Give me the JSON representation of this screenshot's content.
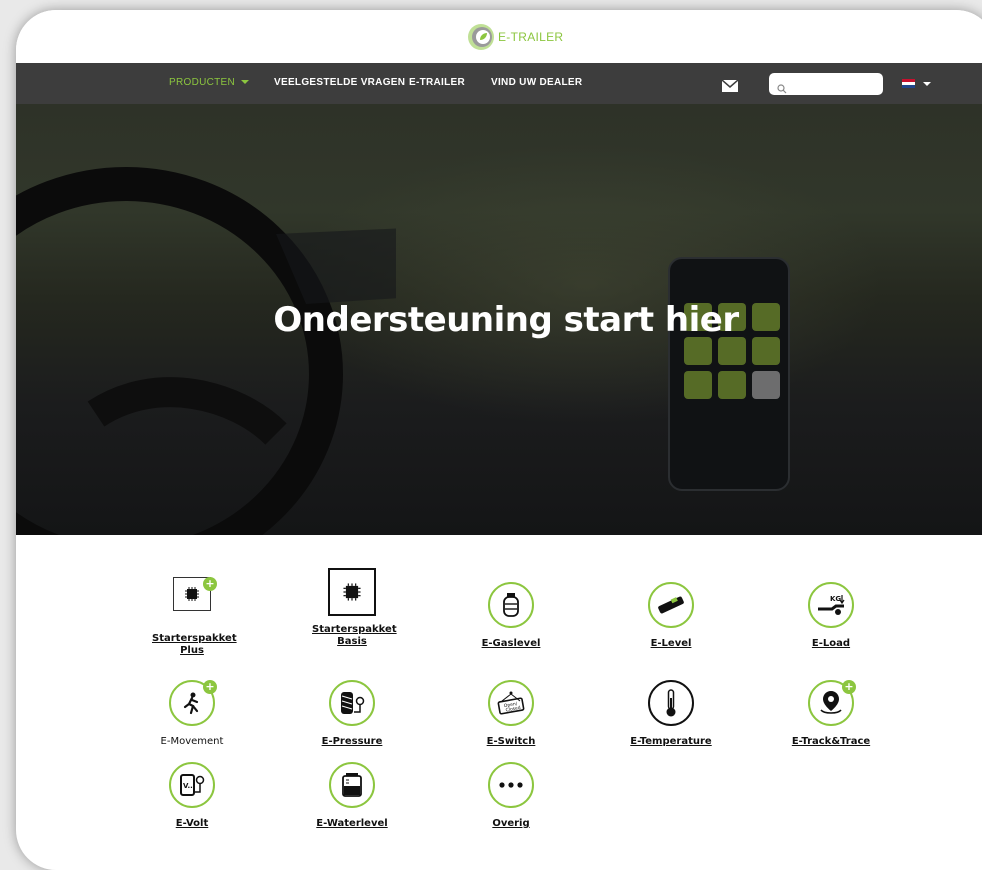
{
  "brand": {
    "logo_text": "E-TRAILER",
    "accent": "#8cc63f",
    "nav_bg": "#3d3d3d"
  },
  "nav": {
    "items": [
      {
        "label": "PRODUCTEN",
        "active": true,
        "dropdown": true
      },
      {
        "label": "VEELGESTELDE VRAGEN"
      },
      {
        "label": "E-TRAILER"
      },
      {
        "label": "VIND UW DEALER"
      }
    ],
    "mail_icon": "envelope-icon",
    "search": {
      "placeholder": "",
      "value": ""
    },
    "language": {
      "flag": "netherlands-flag",
      "dropdown": true
    }
  },
  "hero": {
    "title": "Ondersteuning start hier"
  },
  "products": [
    {
      "label": "Starterspakket Plus",
      "icon": "chip-plus-icon",
      "underline": true
    },
    {
      "label": "Starterspakket Basis",
      "icon": "chip-icon",
      "underline": true
    },
    {
      "label": "E-Gaslevel",
      "icon": "gas-bottle-icon",
      "underline": true
    },
    {
      "label": "E-Level",
      "icon": "spirit-level-icon",
      "underline": true
    },
    {
      "label": "E-Load",
      "icon": "load-kg-icon",
      "underline": true
    },
    {
      "label": "E-Movement",
      "icon": "movement-icon",
      "underline": false
    },
    {
      "label": "E-Pressure",
      "icon": "tire-pressure-icon",
      "underline": true
    },
    {
      "label": "E-Switch",
      "icon": "open-closed-sign-icon",
      "underline": true
    },
    {
      "label": "E-Temperature",
      "icon": "thermometer-icon",
      "underline": true
    },
    {
      "label": "E-Track&Trace",
      "icon": "location-pin-icon",
      "underline": true
    },
    {
      "label": "E-Volt",
      "icon": "battery-volt-icon",
      "underline": true
    },
    {
      "label": "E-Waterlevel",
      "icon": "water-tank-icon",
      "underline": true
    },
    {
      "label": "Overig",
      "icon": "more-dots-icon",
      "underline": true
    }
  ]
}
